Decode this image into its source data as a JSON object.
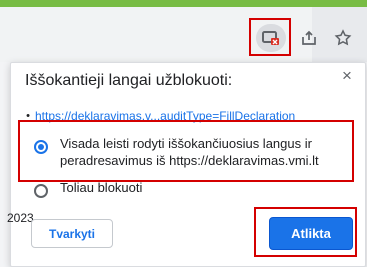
{
  "toolbar": {
    "blocked_popup_icon": "popup-blocked-icon",
    "share_icon": "share-icon",
    "star_icon": "star-icon"
  },
  "popup": {
    "title": "Iššokantieji langai užblokuoti:",
    "close_label": "×",
    "blocked_link": "https://deklaravimas.v...auditType=FillDeclaration",
    "options": [
      {
        "label": "Visada leisti rodyti iššokančiuosius langus ir peradresavimus iš https://deklaravimas.vmi.lt",
        "selected": true
      },
      {
        "label": "Toliau blokuoti",
        "selected": false
      }
    ],
    "background_year": "2023",
    "manage_label": "Tvarkyti",
    "done_label": "Atlikta"
  },
  "colors": {
    "accent": "#1a73e8",
    "highlight": "#d40000",
    "toolbar": "#e8eaed",
    "top_strip": "#78bc44"
  }
}
